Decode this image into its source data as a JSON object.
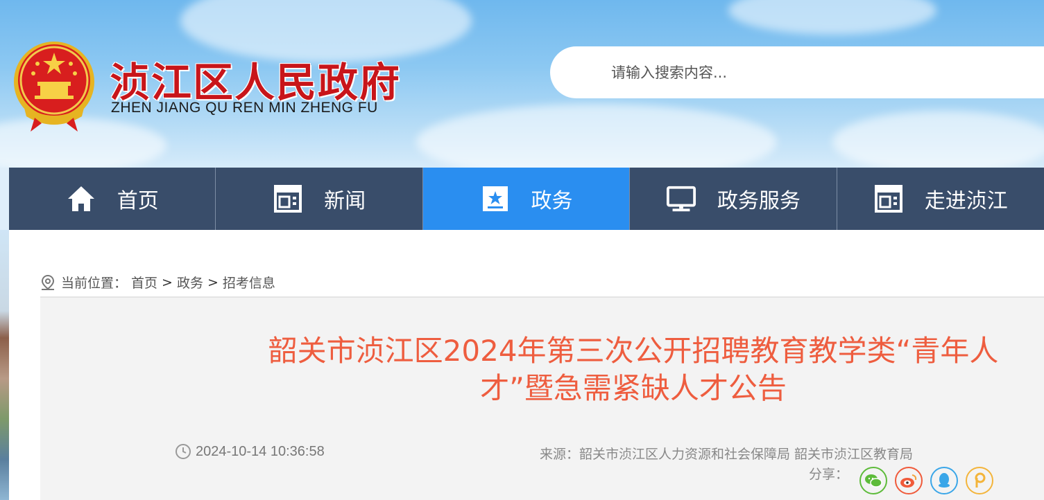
{
  "header": {
    "site_title": "浈江区人民政府",
    "site_pinyin": "ZHEN JIANG QU REN MIN ZHENG FU",
    "search": {
      "placeholder": "请输入搜索内容..."
    }
  },
  "nav": {
    "items": [
      {
        "label": "首页",
        "icon": "home-icon"
      },
      {
        "label": "新闻",
        "icon": "newspaper-icon"
      },
      {
        "label": "政务",
        "icon": "star-badge-icon",
        "active": true
      },
      {
        "label": "政务服务",
        "icon": "monitor-icon"
      },
      {
        "label": "走进浈江",
        "icon": "newspaper-icon"
      }
    ]
  },
  "breadcrumb": {
    "prefix": "当前位置：",
    "items": [
      "首页",
      "政务",
      "招考信息"
    ],
    "separator": ">"
  },
  "article": {
    "title": "韶关市浈江区2024年第三次公开招聘教育教学类“青年人才”暨急需紧缺人才公告",
    "date": "2024-10-14 10:36:58",
    "source": "来源：韶关市浈江区人力资源和社会保障局 韶关市浈江区教育局",
    "share_label": "分享："
  },
  "share_buttons": [
    {
      "name": "wechat-share-icon",
      "color": "#5dbb3a"
    },
    {
      "name": "weibo-share-icon",
      "color": "#f05a3a"
    },
    {
      "name": "qq-share-icon",
      "color": "#3aa6e8"
    },
    {
      "name": "qzone-share-icon",
      "color": "#f3b43a"
    }
  ],
  "colors": {
    "nav_bg": "#394d6a",
    "nav_active": "#2a8ef0",
    "title_red": "#c8151a",
    "article_title": "#ee5d3f"
  }
}
